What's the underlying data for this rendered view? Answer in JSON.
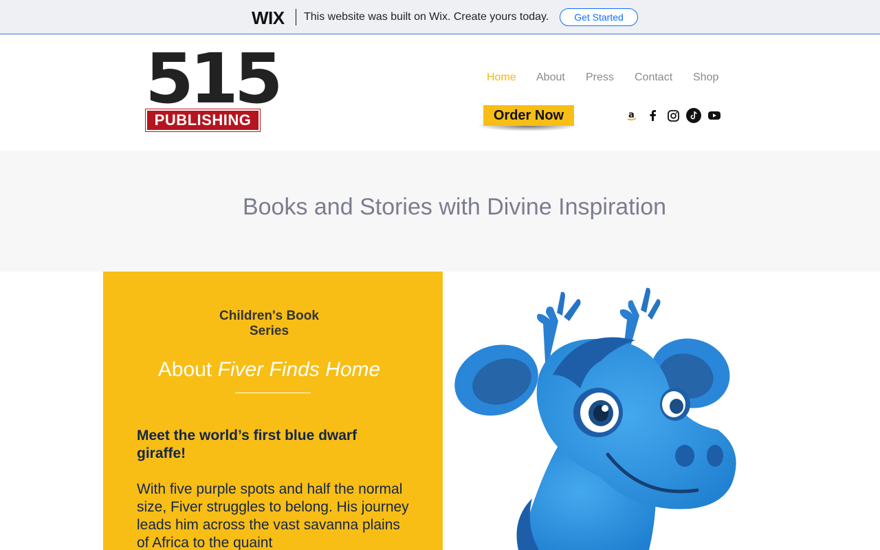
{
  "wix_banner": {
    "logo": "WIX",
    "message": "This website was built on Wix. Create yours today.",
    "cta": "Get Started"
  },
  "brand": {
    "logo_number": "515",
    "logo_word": "PUBLISHING",
    "logo_red": "#b5151e"
  },
  "nav": {
    "items": [
      {
        "label": "Home",
        "active": true
      },
      {
        "label": "About",
        "active": false
      },
      {
        "label": "Press",
        "active": false
      },
      {
        "label": "Contact",
        "active": false
      },
      {
        "label": "Shop",
        "active": false
      }
    ],
    "active_color": "#f5b513"
  },
  "header": {
    "order_label": "Order Now",
    "socials": [
      "amazon-icon",
      "facebook-icon",
      "instagram-icon",
      "tiktok-icon",
      "youtube-icon"
    ]
  },
  "hero": {
    "tagline": "Books and Stories with Divine Inspiration"
  },
  "feature": {
    "series_line1": "Children's Book",
    "series_line2": "Series",
    "about_prefix": "About ",
    "about_title": "Fiver Finds Home",
    "headline": "Meet the world’s first blue dwarf giraffe!",
    "body": "With five purple spots and half the normal size, Fiver struggles to belong. His journey leads him across the vast savanna plains of Africa to the quaint",
    "panel_color": "#f8be15",
    "illustration": "blue-giraffe-illustration"
  }
}
